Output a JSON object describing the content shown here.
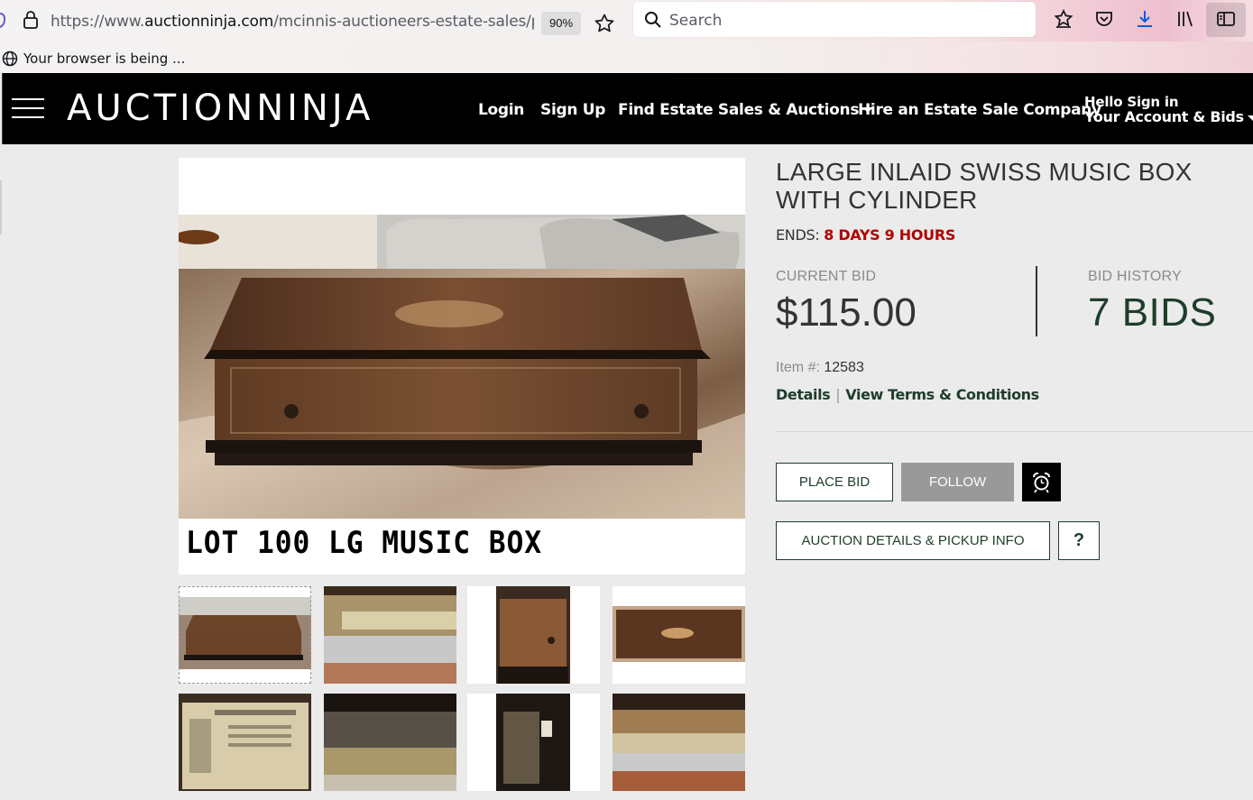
{
  "browser": {
    "url_prefix": "https://www.",
    "url_host": "auctionninja.com",
    "url_path": "/mcinnis-auctioneers-estate-sales/produ",
    "zoom": "90%",
    "search_placeholder": "Search",
    "notice": "Your browser is being ..."
  },
  "header": {
    "logo_text": "AuctionNinja",
    "nav": {
      "login": "Login",
      "signup": "Sign Up",
      "find": "Find Estate Sales & Auctions",
      "hire": "Hire an Estate Sale Company",
      "account_line1": "Hello Sign in",
      "account_line2": "Your Account & Bids"
    }
  },
  "listing": {
    "title": "LARGE INLAID SWISS MUSIC BOX WITH CYLINDER",
    "ends_label": "ENDS:",
    "ends_value": "8 DAYS 9 HOURS",
    "current_bid_label": "CURRENT BID",
    "current_bid_value": "$115.00",
    "bid_history_label": "BID HISTORY",
    "bid_count": "7 BIDS",
    "item_label": "Item #:",
    "item_number": "12583",
    "details_link": "Details",
    "terms_link": "View Terms & Conditions",
    "place_bid": "PLACE BID",
    "follow": "FOLLOW",
    "auction_details": "AUCTION DETAILS & PICKUP INFO",
    "help": "?",
    "image_caption": "LOT 100 LG MUSIC BOX"
  },
  "colors": {
    "accent_green": "#1e3d2a",
    "ends_red": "#b30000",
    "header_bg": "#000000",
    "follow_gray": "#999999"
  }
}
